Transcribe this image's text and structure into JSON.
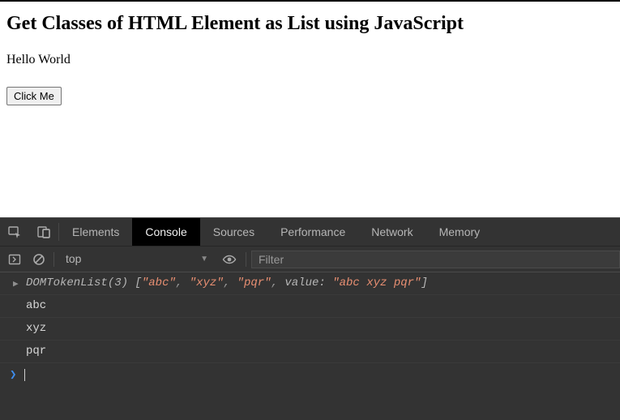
{
  "page": {
    "heading": "Get Classes of HTML Element as List using JavaScript",
    "text": "Hello World",
    "button_label": "Click Me"
  },
  "devtools": {
    "tabs": {
      "elements": "Elements",
      "console": "Console",
      "sources": "Sources",
      "performance": "Performance",
      "network": "Network",
      "memory": "Memory"
    },
    "toolbar": {
      "context": "top",
      "filter_placeholder": "Filter"
    },
    "console": {
      "tokenlist": {
        "type": "DOMTokenList",
        "count": "(3)",
        "items": [
          "abc",
          "xyz",
          "pqr"
        ],
        "value_key": "value:",
        "value": "abc xyz pqr"
      },
      "lines": [
        "abc",
        "xyz",
        "pqr"
      ]
    }
  }
}
